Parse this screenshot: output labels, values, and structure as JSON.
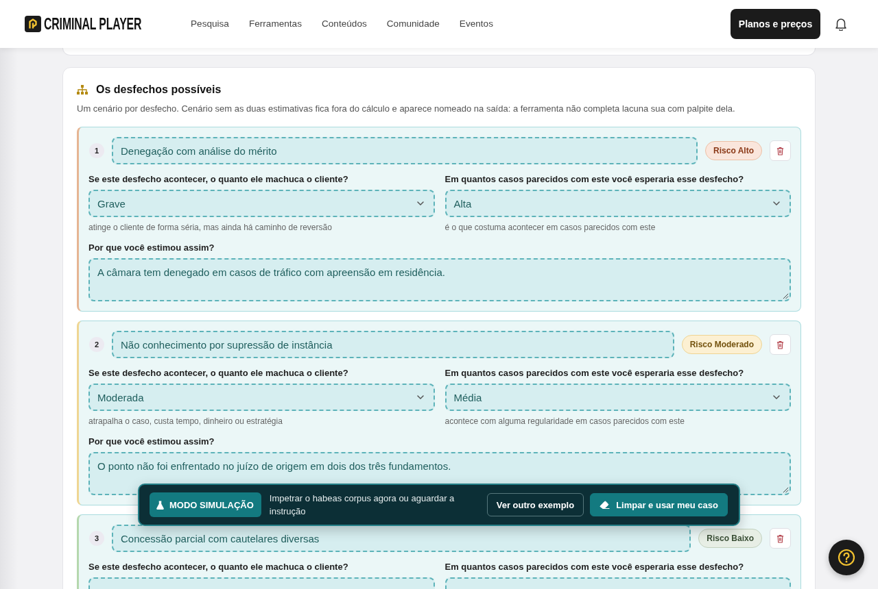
{
  "header": {
    "brand": "CRIMINAL PLAYER",
    "nav": [
      {
        "label": "Pesquisa"
      },
      {
        "label": "Ferramentas"
      },
      {
        "label": "Conteúdos"
      },
      {
        "label": "Comunidade"
      },
      {
        "label": "Eventos"
      }
    ],
    "cta": "Planos e preços"
  },
  "section": {
    "title": "Os desfechos possíveis",
    "description": "Um cenário por desfecho. Cenário sem as duas estimativas fica fora do cálculo e aparece nomeado na saída: a ferramenta não completa lacuna sua com palpite dela.",
    "outcomes": [
      {
        "number": "1",
        "title": "Denegação com análise do mérito",
        "risk": {
          "label": "Risco Alto",
          "kind": "high"
        },
        "impact": {
          "label": "Se este desfecho acontecer, o quanto ele machuca o cliente?",
          "value": "Grave",
          "hint": "atinge o cliente de forma séria, mas ainda há caminho de reversão"
        },
        "likelihood": {
          "label": "Em quantos casos parecidos com este você esperaria esse desfecho?",
          "value": "Alta",
          "hint": "é o que costuma acontecer em casos parecidos com este"
        },
        "reason": {
          "label": "Por que você estimou assim?",
          "value": "A câmara tem denegado em casos de tráfico com apreensão em residência."
        }
      },
      {
        "number": "2",
        "title": "Não conhecimento por supressão de instância",
        "risk": {
          "label": "Risco Moderado",
          "kind": "medium"
        },
        "impact": {
          "label": "Se este desfecho acontecer, o quanto ele machuca o cliente?",
          "value": "Moderada",
          "hint": "atrapalha o caso, custa tempo, dinheiro ou estratégia"
        },
        "likelihood": {
          "label": "Em quantos casos parecidos com este você esperaria esse desfecho?",
          "value": "Média",
          "hint": "acontece com alguma regularidade em casos parecidos com este"
        },
        "reason": {
          "label": "Por que você estimou assim?",
          "value": "O ponto não foi enfrentado no juízo de origem em dois dos três fundamentos."
        }
      },
      {
        "number": "3",
        "title": "Concessão parcial com cautelares diversas",
        "risk": {
          "label": "Risco Baixo",
          "kind": "low"
        },
        "impact": {
          "label": "Se este desfecho acontecer, o quanto ele machuca o cliente?"
        },
        "likelihood": {
          "label": "Em quantos casos parecidos com este você esperaria esse desfecho?"
        }
      }
    ]
  },
  "simulation_bar": {
    "badge": "MODO SIMULAÇÃO",
    "message": "Impetrar o habeas corpus agora ou aguardar a instrução",
    "buttons": [
      {
        "label": "Ver outro exemplo",
        "kind": "outline"
      },
      {
        "label": "Limpar e usar meu caso",
        "kind": "primary"
      }
    ]
  }
}
